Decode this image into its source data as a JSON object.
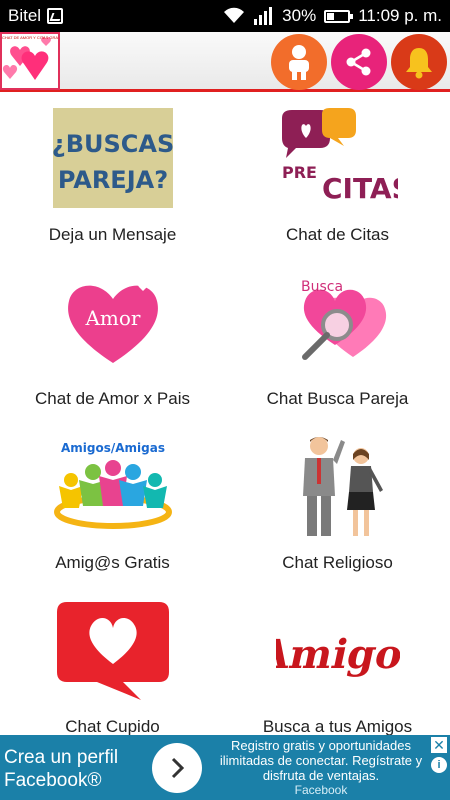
{
  "status_bar": {
    "carrier": "Bitel",
    "battery": "30%",
    "battery_level": 0.3,
    "time": "11:09 p. m."
  },
  "toolbar": {
    "logo_text": "CHAT DE AMOR Y CITAS GRATIS",
    "buttons": [
      {
        "icon": "person-icon",
        "color": "#f26d2b"
      },
      {
        "icon": "share-icon",
        "color": "#e8237a"
      },
      {
        "icon": "bell-icon",
        "color": "#d93a18"
      }
    ]
  },
  "menu": {
    "items": [
      {
        "label": "Deja un Mensaje",
        "image_text": "¿BUSCAS PAREJA?"
      },
      {
        "label": "Chat de Citas",
        "image_text": "PRE CITAS"
      },
      {
        "label": "Chat de Amor x Pais",
        "image_text": "Amor"
      },
      {
        "label": "Chat Busca Pareja",
        "image_text": "Busca"
      },
      {
        "label": "Amig@s Gratis",
        "image_text": "Amigos/Amigas"
      },
      {
        "label": "Chat Religioso",
        "image_text": ""
      },
      {
        "label": "Chat Cupido",
        "image_text": ""
      },
      {
        "label": "Busca a tus Amigos",
        "image_text": "Amigos"
      }
    ]
  },
  "ad": {
    "headline": "Crea un perfil Facebook®",
    "body": "Registro gratis y oportunidades ilimitadas de conectar. Regístrate y disfruta de ventajas.",
    "advertiser": "Facebook",
    "close": "✕",
    "info": "i"
  }
}
